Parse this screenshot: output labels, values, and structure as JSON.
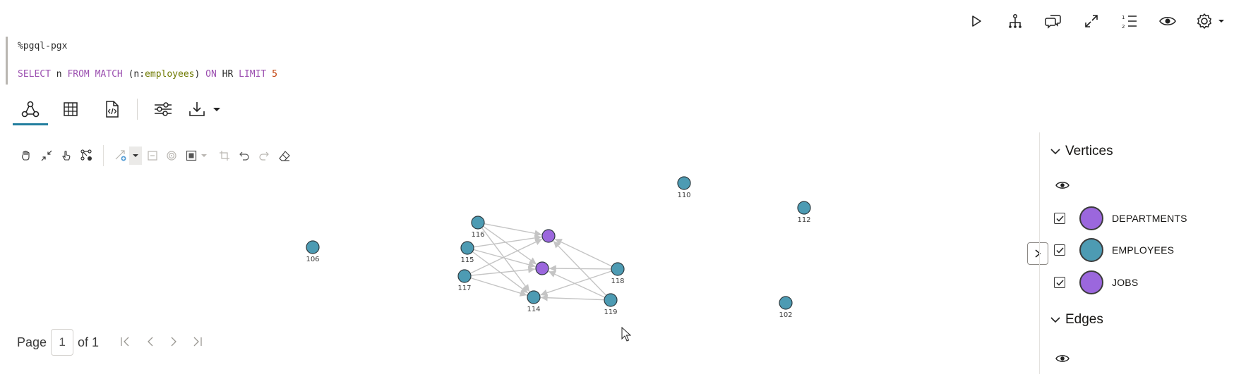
{
  "toolbar": {
    "icons": [
      "run-icon",
      "hierarchy-icon",
      "comment-icon",
      "expand-icon",
      "numbered-list-icon",
      "eye-icon",
      "settings-icon"
    ]
  },
  "editor": {
    "line1": "%pgql-pgx",
    "line2_tokens": {
      "select": "SELECT",
      "n": "n",
      "from": "FROM",
      "match": "MATCH",
      "open": "(n:",
      "label": "employees",
      "close": ")",
      "on": "ON",
      "graph": "HR",
      "limit": "LIMIT",
      "count": "5"
    }
  },
  "result_tabs": [
    {
      "id": "graph",
      "icon": "graph-icon",
      "active": true
    },
    {
      "id": "table",
      "icon": "table-icon",
      "active": false
    },
    {
      "id": "json",
      "icon": "code-file-icon",
      "active": false
    }
  ],
  "graph": {
    "colors": {
      "employee": "#4d9bb3",
      "job": "#9b67dd",
      "edge": "#c4c4c4",
      "accent": "#227e9e"
    },
    "vertices": [
      {
        "id": "110",
        "label": "110",
        "type": "employee"
      },
      {
        "id": "112",
        "label": "112",
        "type": "employee"
      },
      {
        "id": "106",
        "label": "106",
        "type": "employee"
      },
      {
        "id": "116",
        "label": "116",
        "type": "employee"
      },
      {
        "id": "115",
        "label": "115",
        "type": "employee"
      },
      {
        "id": "117",
        "label": "117",
        "type": "employee"
      },
      {
        "id": "114",
        "label": "114",
        "type": "employee"
      },
      {
        "id": "118",
        "label": "118",
        "type": "employee"
      },
      {
        "id": "119",
        "label": "119",
        "type": "employee"
      },
      {
        "id": "102",
        "label": "102",
        "type": "employee"
      },
      {
        "id": "j1",
        "label": "",
        "type": "job"
      },
      {
        "id": "j2",
        "label": "",
        "type": "job"
      }
    ],
    "edges": [
      [
        "116",
        "j1"
      ],
      [
        "116",
        "j2"
      ],
      [
        "116",
        "114"
      ],
      [
        "115",
        "j1"
      ],
      [
        "115",
        "j2"
      ],
      [
        "115",
        "114"
      ],
      [
        "117",
        "j2"
      ],
      [
        "117",
        "j1"
      ],
      [
        "117",
        "114"
      ],
      [
        "118",
        "j1"
      ],
      [
        "118",
        "j2"
      ],
      [
        "118",
        "114"
      ],
      [
        "119",
        "j1"
      ],
      [
        "119",
        "j2"
      ],
      [
        "119",
        "114"
      ]
    ]
  },
  "pagination": {
    "page_label": "Page",
    "current": "1",
    "of_label": "of 1"
  },
  "legend": {
    "vertices_title": "Vertices",
    "vertex_types": [
      {
        "label": "DEPARTMENTS",
        "color": "#9b67dd",
        "checked": true
      },
      {
        "label": "EMPLOYEES",
        "color": "#4d9bb3",
        "checked": true
      },
      {
        "label": "JOBS",
        "color": "#9b67dd",
        "checked": true
      }
    ],
    "edges_title": "Edges"
  }
}
